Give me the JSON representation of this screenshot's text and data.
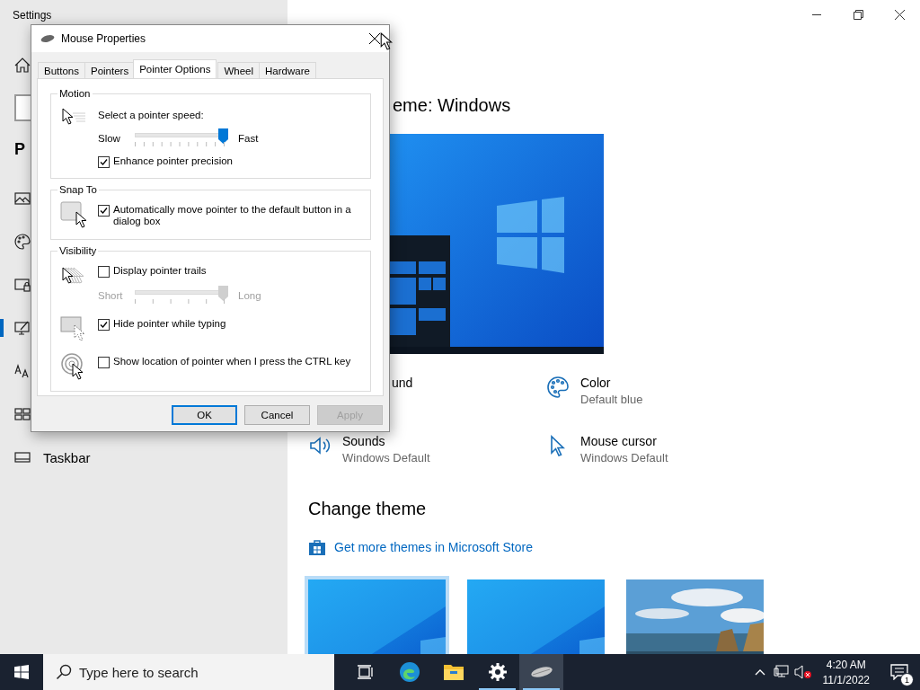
{
  "settings_window": {
    "title": "Settings",
    "sidebar": {
      "heading": "P",
      "items": [
        {
          "kind": "background",
          "selected": false
        },
        {
          "kind": "colors",
          "selected": false
        },
        {
          "kind": "lockscreen",
          "selected": false
        },
        {
          "kind": "themes",
          "selected": true
        },
        {
          "kind": "fonts",
          "selected": false
        },
        {
          "kind": "start",
          "selected": false
        },
        {
          "kind": "taskbar",
          "label": "Taskbar",
          "selected": false
        }
      ]
    },
    "page": {
      "theme_title": "eme: Windows",
      "properties": [
        {
          "kind": "background",
          "title": "und"
        },
        {
          "kind": "color",
          "title": "Color",
          "value": "Default blue"
        },
        {
          "kind": "sounds",
          "title": "Sounds",
          "value": "Windows Default"
        },
        {
          "kind": "cursor",
          "title": "Mouse cursor",
          "value": "Windows Default"
        }
      ],
      "change_theme": {
        "heading": "Change theme",
        "link": "Get more themes in Microsoft Store",
        "themes": [
          {
            "kind": "bluewin",
            "selected": true
          },
          {
            "kind": "bluewin",
            "selected": false
          },
          {
            "kind": "coast",
            "selected": false
          }
        ]
      }
    }
  },
  "dialog": {
    "title": "Mouse Properties",
    "tabs": [
      {
        "label": "Buttons",
        "selected": false
      },
      {
        "label": "Pointers",
        "selected": false
      },
      {
        "label": "Pointer Options",
        "selected": true
      },
      {
        "label": "Wheel",
        "selected": false
      },
      {
        "label": "Hardware",
        "selected": false
      }
    ],
    "groups": [
      {
        "legend": "Motion",
        "rows": [
          {
            "kind": "speed",
            "prompt": "Select a pointer speed:",
            "slider": {
              "min_label": "Slow",
              "max_label": "Fast",
              "level": 1,
              "disabled": false
            },
            "label": "Enhance pointer precision",
            "checked": true
          }
        ]
      },
      {
        "legend": "Snap To",
        "rows": [
          {
            "kind": "snap",
            "label": "Automatically move pointer to the default button in a dialog box",
            "checked": true
          }
        ]
      },
      {
        "legend": "Visibility",
        "rows": [
          {
            "kind": "trails",
            "label": "Display pointer trails",
            "checked": false,
            "slider": {
              "min_label": "Short",
              "max_label": "Long",
              "level": 1,
              "disabled": true
            }
          },
          {
            "kind": "hide",
            "label": "Hide pointer while typing",
            "checked": true
          },
          {
            "kind": "locate",
            "label": "Show location of pointer when I press the CTRL key",
            "checked": false
          }
        ]
      }
    ],
    "buttons": [
      {
        "label": "OK",
        "default": true,
        "disabled": false
      },
      {
        "label": "Cancel",
        "default": false,
        "disabled": false
      },
      {
        "label": "Apply",
        "default": false,
        "disabled": true
      }
    ]
  },
  "taskbar": {
    "search": {
      "placeholder": "Type here to search"
    },
    "apps": [
      {
        "kind": "taskview",
        "running": false,
        "active": false
      },
      {
        "kind": "edge",
        "running": false,
        "active": false
      },
      {
        "kind": "folder",
        "running": false,
        "active": false
      },
      {
        "kind": "settings",
        "running": true,
        "active": false
      },
      {
        "kind": "mouse",
        "running": true,
        "active": true
      }
    ],
    "clock": {
      "time": "4:20 AM",
      "date": "11/1/2022"
    },
    "notifications": {
      "count": "1"
    }
  }
}
